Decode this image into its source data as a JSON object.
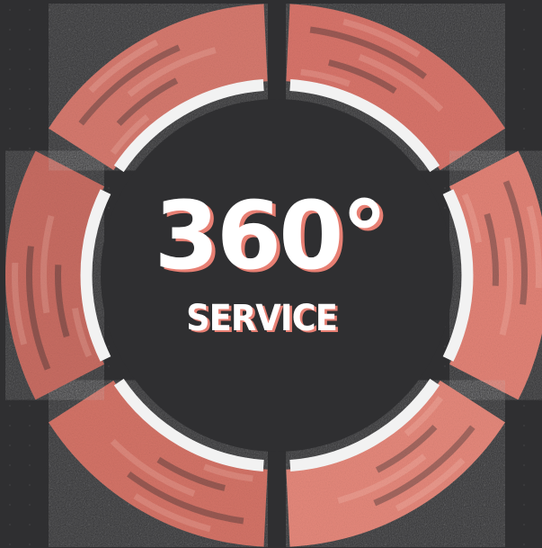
{
  "title": {
    "value": "360°",
    "label": "SERVICE"
  },
  "colors": {
    "background": "#2f2f31",
    "accent": "#e77f73",
    "ring": "#f2f2f2",
    "text": "#ffffff"
  },
  "segments": [
    {
      "name": "segment-camera-photo",
      "icon": "camera-lens-photo",
      "tone": "#d9756b"
    },
    {
      "name": "segment-keyboard-photo",
      "icon": "keyboard-hands-photo",
      "tone": "#e38377"
    },
    {
      "name": "segment-keypad-photo",
      "icon": "keypad-photo",
      "tone": "#e6897c"
    },
    {
      "name": "segment-circuit-board-photo",
      "icon": "circuit-board-photo",
      "tone": "#d57468"
    },
    {
      "name": "segment-code-screen-photo",
      "icon": "code-screen-photo",
      "tone": "#c96d63"
    },
    {
      "name": "segment-smartphone-apps-photo",
      "icon": "smartphone-apps-photo",
      "tone": "#d77a6f"
    }
  ]
}
